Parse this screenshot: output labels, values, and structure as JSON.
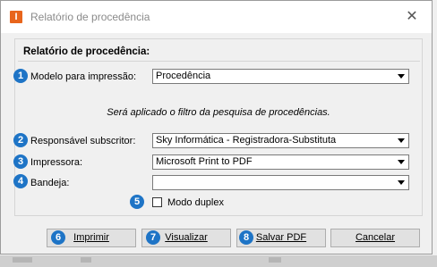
{
  "window": {
    "title": "Relatório de procedência",
    "app_icon_letter": "I",
    "close_glyph": "✕"
  },
  "group": {
    "title": "Relatório de procedência:"
  },
  "fields": {
    "modelo": {
      "badge": "1",
      "label": "Modelo para impressão:",
      "value": "Procedência"
    },
    "info_text": "Será aplicado o filtro da pesquisa de procedências.",
    "responsavel": {
      "badge": "2",
      "label": "Responsável subscritor:",
      "value": "Sky Informática - Registradora-Substituta"
    },
    "impressora": {
      "badge": "3",
      "label": "Impressora:",
      "value": "Microsoft Print to PDF"
    },
    "bandeja": {
      "badge": "4",
      "label": "Bandeja:",
      "value": ""
    },
    "duplex": {
      "badge": "5",
      "label": "Modo duplex",
      "checked": false
    }
  },
  "buttons": {
    "imprimir": {
      "badge": "6",
      "label": "Imprimir"
    },
    "visualizar": {
      "badge": "7",
      "label": "Visualizar"
    },
    "salvar": {
      "badge": "8",
      "label": "Salvar PDF"
    },
    "cancelar": {
      "label": "Cancelar"
    }
  },
  "colors": {
    "badge": "#1e74c6",
    "app_icon": "#e8651c"
  }
}
